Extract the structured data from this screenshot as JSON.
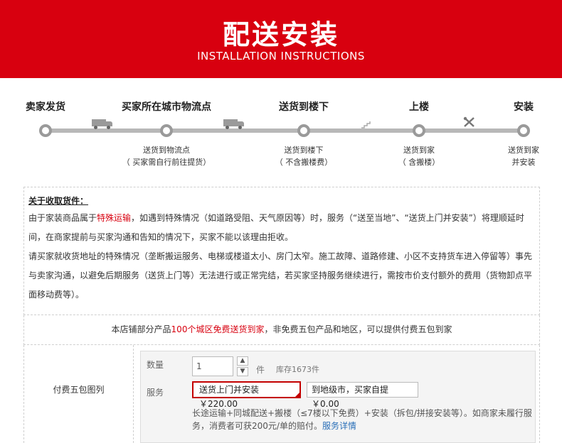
{
  "banner": {
    "title": "配送安装",
    "subtitle": "INSTALLATION INSTRUCTIONS"
  },
  "steps": [
    {
      "label": "卖家发货",
      "sub1": "",
      "sub2": ""
    },
    {
      "label": "买家所在城市物流点",
      "sub1": "送货到物流点",
      "sub2": "（ 买家需自行前往提货）"
    },
    {
      "label": "送货到楼下",
      "sub1": "送货到楼下",
      "sub2": "（ 不含搬楼费）"
    },
    {
      "label": "上楼",
      "sub1": "送货到家",
      "sub2": "（ 含搬楼）"
    },
    {
      "label": "安装",
      "sub1": "送货到家",
      "sub2": "并安装"
    }
  ],
  "icons": {
    "truck1": "truck-icon",
    "truck2": "truck-icon",
    "stairs": "stairs-icon",
    "tools": "tools-icon"
  },
  "notice": {
    "title": "关于收取货件：",
    "p1_a": "由于家装商品属于",
    "p1_hl": "特殊运输",
    "p1_b": "，如遇到特殊情况（如道路受阻、天气原因等）时，服务（“送至当地”、“送货上门并安装”）将理顺延时间，在商家提前与买家沟通和告知的情况下，买家不能以该理由拒收。",
    "p2": "请买家就收货地址的特殊情况（垄断搬运服务、电梯或楼道太小、房门太窄。施工故障、道路修建、小区不支持货车进入停留等）事先与卖家沟通，以避免后期服务（送货上门等）无法进行或正常完结，若买家坚持服务继续进行，需按市价支付额外的费用（货物卸点平面移动费等）。"
  },
  "freebar": {
    "a": "本店铺部分产品",
    "hl": "100个城区免费送货到家",
    "b": "，非免费五包产品和地区，可以提供付费五包到家"
  },
  "bottom": {
    "label": "付费五包图列",
    "qty_label": "数量",
    "qty_value": "1",
    "unit": "件",
    "stock": "库存1673件",
    "svc_label": "服务",
    "opt1": "送货上门并安装 ￥220.00",
    "opt2": "到地级市，买家自提 ￥0.00",
    "desc": "长途运输+同城配送+搬楼（≤7楼以下免费）+安装（拆包/拼接安装等）。如商家未履行服务，消费者可获200元/单的赔付。",
    "link": "服务详情"
  },
  "colors": {
    "brand": "#d8000f",
    "accent": "#c40000",
    "link": "#2a6fb8"
  }
}
